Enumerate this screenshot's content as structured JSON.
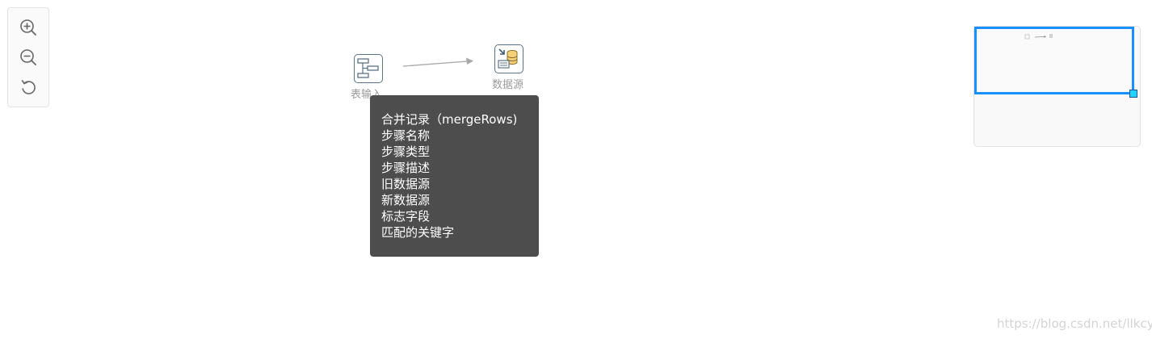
{
  "toolbar": {
    "zoom_in_icon": "zoom-in-icon",
    "zoom_out_icon": "zoom-out-icon",
    "reset_icon": "reset-icon"
  },
  "nodes": [
    {
      "label": "表输入",
      "icon": "table-input-icon"
    },
    {
      "label": "数据源",
      "icon": "data-source-icon"
    }
  ],
  "tooltip": {
    "lines": [
      "合并记录（mergeRows)",
      "步骤名称",
      "步骤类型",
      "步骤描述",
      "旧数据源",
      "新数据源",
      "标志字段",
      "匹配的关键字"
    ]
  },
  "watermark": "https://blog.csdn.net/llkcyc",
  "colors": {
    "node_border": "#5a7388",
    "edge": "#a8a8a8",
    "tooltip_bg": "#4d4d4d",
    "minimap_viewport": "#1890ff",
    "minimap_handle": "#21d4f7"
  }
}
